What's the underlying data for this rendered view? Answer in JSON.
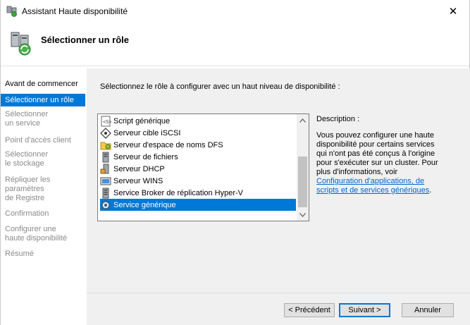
{
  "window": {
    "title": "Assistant Haute disponibilité",
    "close_glyph": "✕"
  },
  "header": {
    "title": "Sélectionner un rôle"
  },
  "sidebar": {
    "items": [
      {
        "label": "Avant de commencer",
        "state": "done"
      },
      {
        "label": "Sélectionner un rôle",
        "state": "active"
      },
      {
        "label": "Sélectionner un service",
        "state": "pending"
      },
      {
        "label": "Point d'accès client",
        "state": "pending"
      },
      {
        "label": "Sélectionner le stockage",
        "state": "pending"
      },
      {
        "label": "Répliquer les paramètres de Registre",
        "state": "pending"
      },
      {
        "label": "Confirmation",
        "state": "pending"
      },
      {
        "label": "Configurer une haute disponibilité",
        "state": "pending"
      },
      {
        "label": "Résumé",
        "state": "pending"
      }
    ]
  },
  "main": {
    "instruction": "Sélectionnez le rôle à configurer avec un haut niveau de disponibilité :",
    "roles": [
      {
        "label": "Script générique",
        "icon": "script-icon"
      },
      {
        "label": "Serveur cible iSCSI",
        "icon": "iscsi-target-icon"
      },
      {
        "label": "Serveur d'espace de noms DFS",
        "icon": "dfs-namespace-icon"
      },
      {
        "label": "Serveur de fichiers",
        "icon": "file-server-icon"
      },
      {
        "label": "Serveur DHCP",
        "icon": "dhcp-icon"
      },
      {
        "label": "Serveur WINS",
        "icon": "wins-icon"
      },
      {
        "label": "Service Broker de réplication Hyper-V",
        "icon": "hyperv-broker-icon"
      },
      {
        "label": "Service générique",
        "icon": "generic-service-icon",
        "selected": true
      }
    ],
    "description": {
      "label": "Description :",
      "text": "Vous pouvez configurer une haute disponibilité pour certains services qui n'ont pas été conçus à l'origine pour s'exécuter sur un cluster. Pour plus d'informations, voir ",
      "link": "Configuration d'applications, de scripts et de services génériques",
      "end": "."
    }
  },
  "footer": {
    "prev_label": "< Précédent",
    "next_label": "Suivant >",
    "cancel_label": "Annuler"
  },
  "colors": {
    "accent": "#0078d7",
    "panel": "#f0f0f0",
    "link": "#0066cc"
  }
}
